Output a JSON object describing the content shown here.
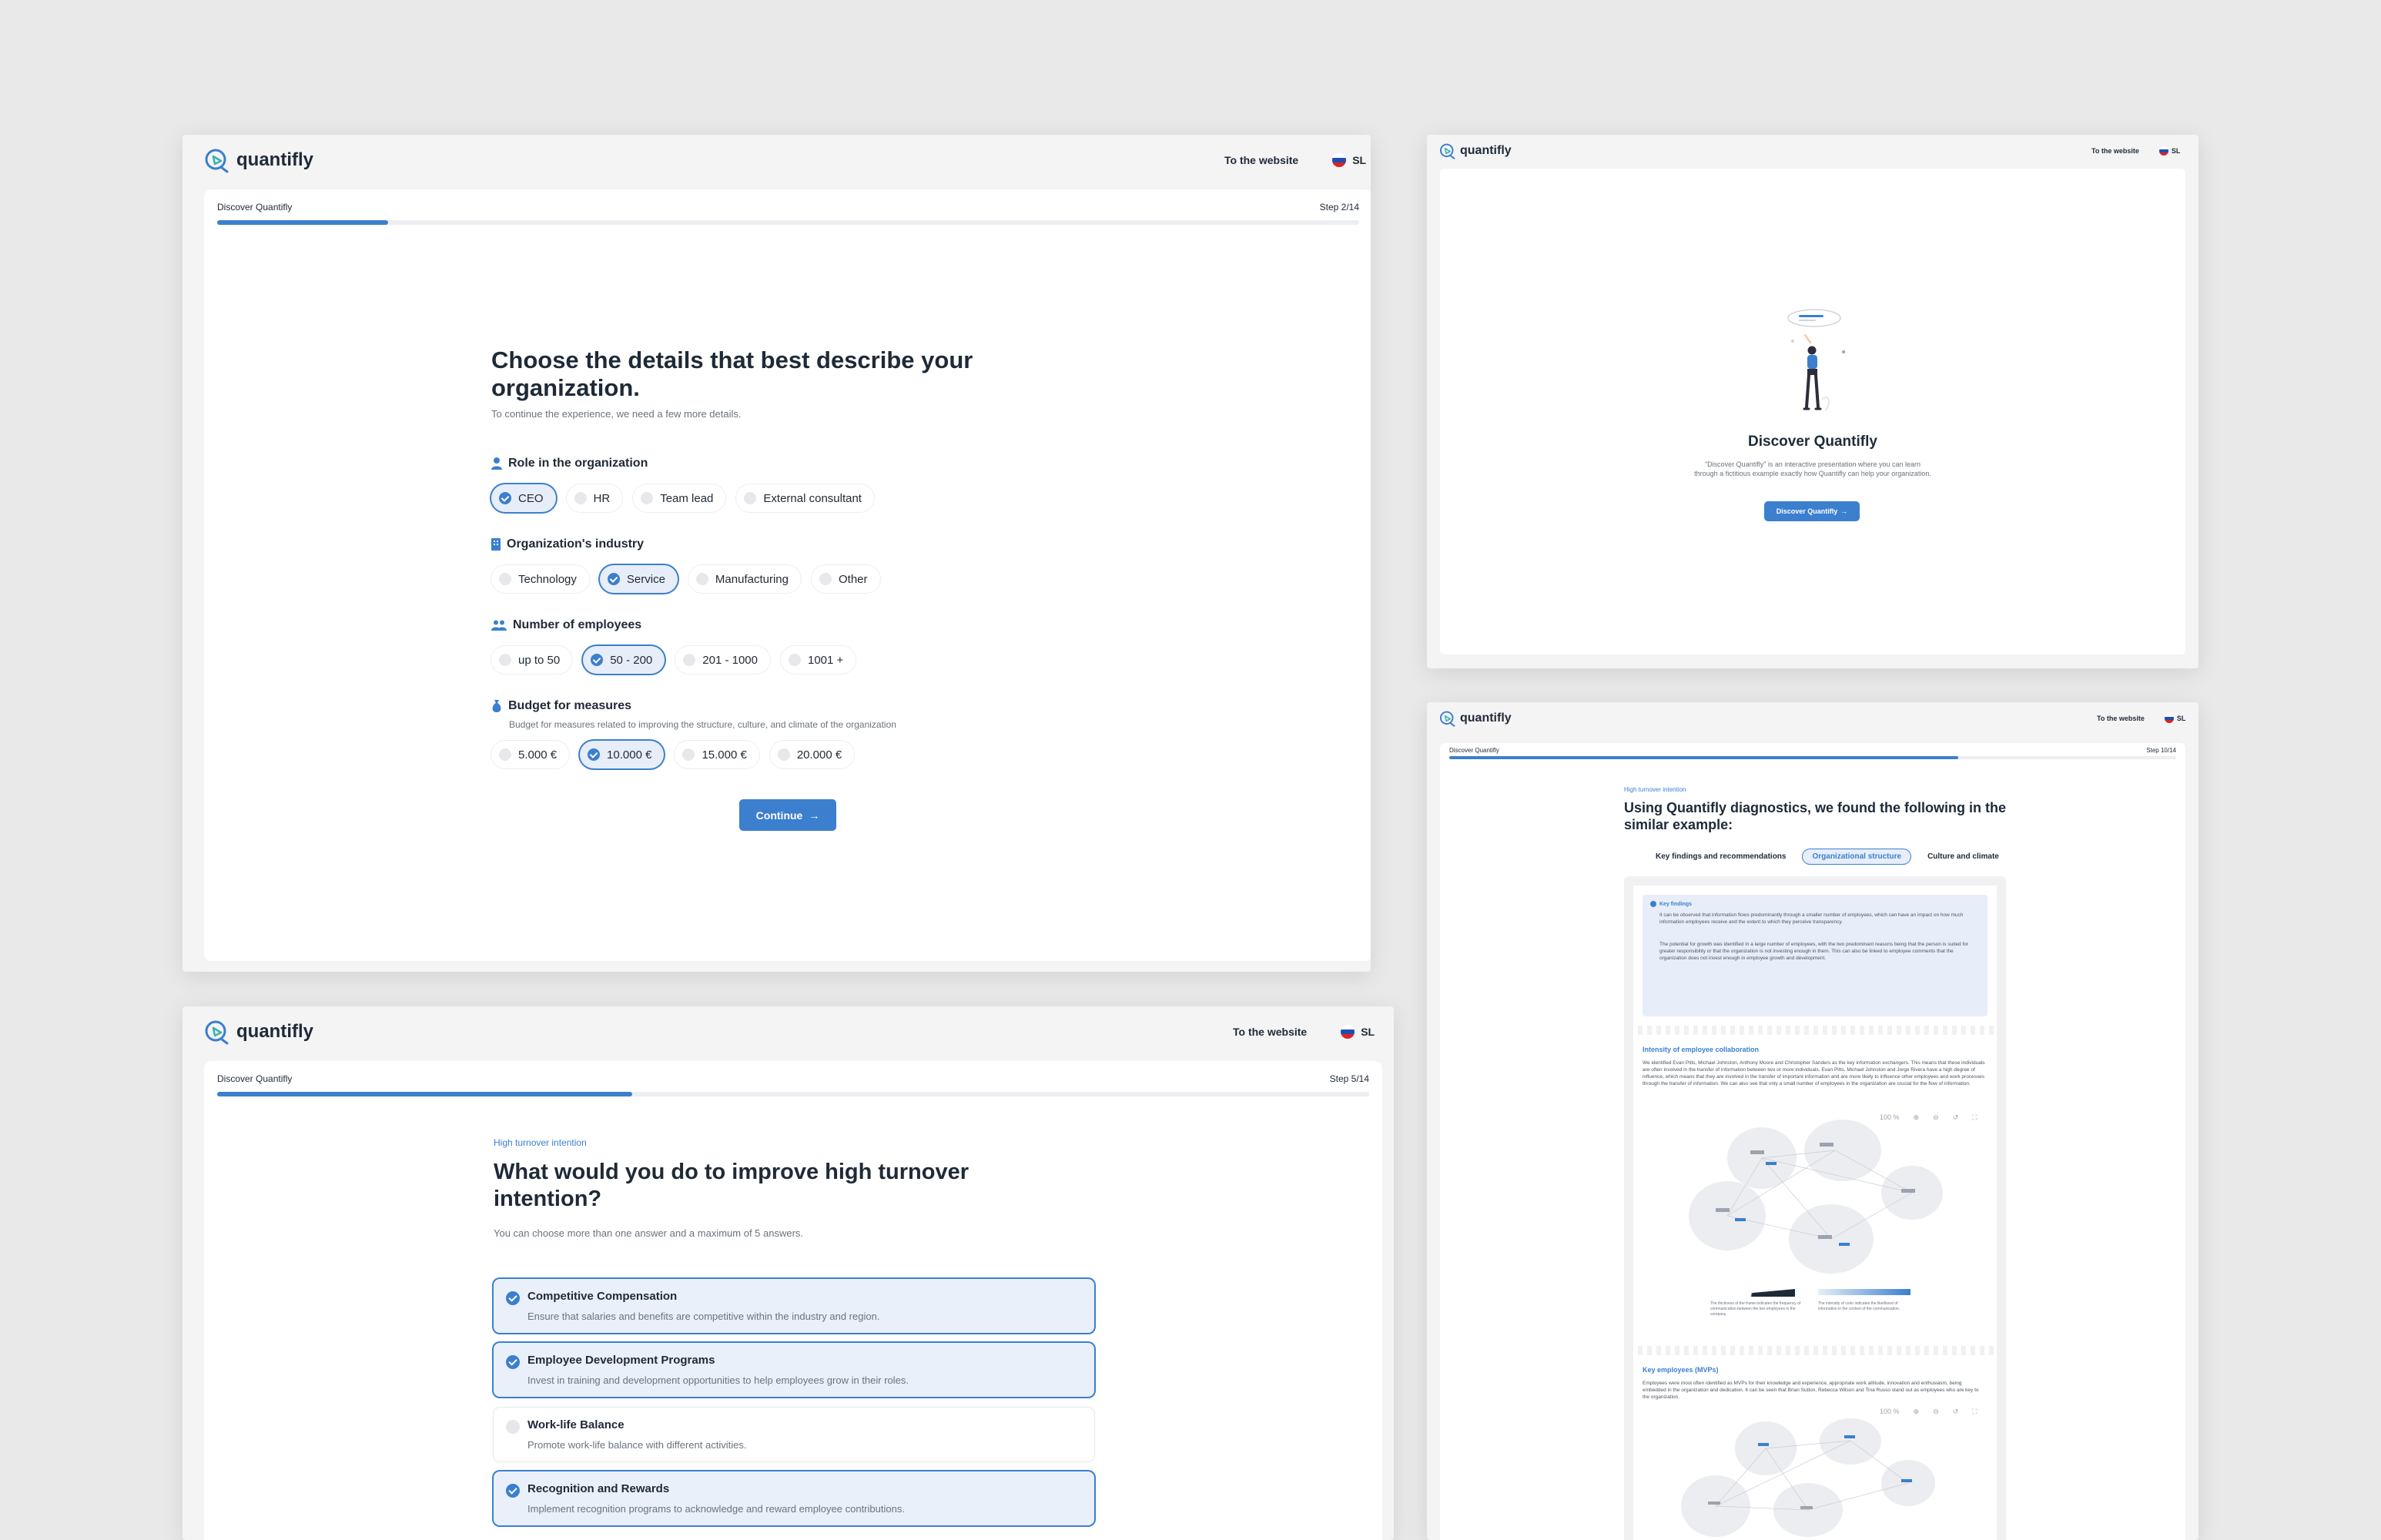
{
  "brand": {
    "name": "quantifly",
    "accent": "#3b7fce"
  },
  "nav": {
    "website": "To the website",
    "lang": "SL"
  },
  "screen1": {
    "progress_label": "Discover Quantifly",
    "step": "Step 2/14",
    "progress": 0.15,
    "title": "Choose the details that best describe your organization.",
    "subtitle": "To continue the experience, we need a few more details.",
    "sections": [
      {
        "label": "Role in the organization",
        "icon": "person-icon",
        "options": [
          "CEO",
          "HR",
          "Team lead",
          "External consultant"
        ],
        "selected": 0
      },
      {
        "label": "Organization's industry",
        "icon": "building-icon",
        "options": [
          "Technology",
          "Service",
          "Manufacturing",
          "Other"
        ],
        "selected": 1
      },
      {
        "label": "Number of employees",
        "icon": "people-icon",
        "options": [
          "up to 50",
          "50 - 200",
          "201 - 1000",
          "1001 +"
        ],
        "selected": 1
      },
      {
        "label": "Budget for measures",
        "icon": "money-bag-icon",
        "description": "Budget for measures related to improving the structure, culture, and climate of the organization",
        "options": [
          "5.000 €",
          "10.000 €",
          "15.000 €",
          "20.000 €"
        ],
        "selected": 1
      }
    ],
    "continue": "Continue"
  },
  "screen2": {
    "title": "Discover Quantifly",
    "description": "\"Discover Quantifly\" is an interactive presentation where you can learn through a fictitious example exactly how Quantifly can help your organization.",
    "button": "Discover Quantifly"
  },
  "screen3": {
    "progress_label": "Discover Quantifly",
    "step": "Step 5/14",
    "progress": 0.36,
    "tag": "High turnover intention",
    "title": "What would you do to improve high turnover intention?",
    "subtitle": "You can choose more than one answer and a maximum of 5 answers.",
    "answers": [
      {
        "title": "Competitive Compensation",
        "description": "Ensure that salaries and benefits are competitive within the industry and region.",
        "selected": true
      },
      {
        "title": "Employee Development Programs",
        "description": "Invest in training and development opportunities to help employees grow in their roles.",
        "selected": true
      },
      {
        "title": "Work-life Balance",
        "description": "Promote work-life balance with different activities.",
        "selected": false
      },
      {
        "title": "Recognition and Rewards",
        "description": "Implement recognition programs to acknowledge and reward employee contributions.",
        "selected": true
      }
    ]
  },
  "screen4": {
    "progress_label": "Discover Quantifly",
    "step": "Step 10/14",
    "progress": 0.7,
    "tag": "High turnover intention",
    "title": "Using Quantifly diagnostics, we found the following in the similar example:",
    "tabs": [
      "Key findings and recommendations",
      "Organizational structure",
      "Culture and climate"
    ],
    "selected_tab": 1,
    "key_findings": {
      "heading": "Key findings",
      "items": [
        "It can be observed that information flows predominantly through a smaller number of employees, which can have an impact on how much information employees receive and the extent to which they perceive transparency.",
        "The potential for growth was identified in a large number of employees, with the two predominant reasons being that the person is suited for greater responsibility or that the organization is not investing enough in them. This can also be linked to employee comments that the organization does not invest enough in employee growth and development."
      ]
    },
    "collab": {
      "heading": "Intensity of employee collaboration",
      "text": "We identified Evan Pitts, Michael Johnston, Anthony Moore and Christopher Sanders as the key information exchangers. This means that these individuals are often involved in the transfer of information between two or more individuals. Evan Pitts, Michael Johnston and Jorge Rivera have a high degree of influence, which means that they are involved in the transfer of important information and are more likely to influence other employees and work processes through the transfer of information. We can also see that only a small number of employees in the organization are crucial for the flow of information.",
      "zoom": "100 %",
      "legend_left": "The thickness of the frame indicates the frequency of communication between the two employees in the company.",
      "legend_right": "The intensity of color indicates the likelihood of information in the context of the communication."
    },
    "mvp": {
      "heading": "Key employees (MVPs)",
      "text": "Employees were most often identified as MVPs for their knowledge and experience, appropriate work attitude, innovation and enthusiasm, being embedded in the organization and dedication. It can be seen that Brian Sutton, Rebecca Wilson and Tina Russo stand out as employees who are key to the organization.",
      "zoom": "100 %"
    }
  }
}
